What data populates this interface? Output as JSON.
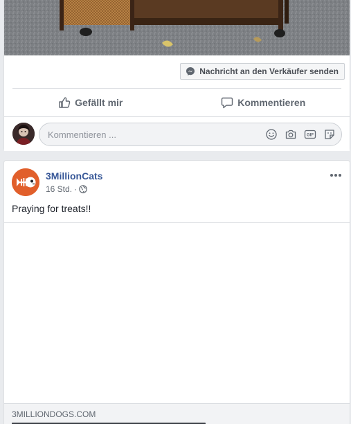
{
  "post1": {
    "message_seller_label": "Nachricht an den Verkäufer senden",
    "like_label": "Gefällt mir",
    "comment_label": "Kommentieren",
    "comment_placeholder": "Kommentieren ...",
    "comment_tool_icons": [
      "emoji-icon",
      "camera-icon",
      "gif-icon",
      "sticker-icon"
    ]
  },
  "post2": {
    "page_name": "3MillionCats",
    "timestamp": "16 Std.",
    "meta_separator": "·",
    "audience_icon": "globe-icon",
    "text": "Praying for treats!!",
    "link_domain": "3MILLIONDOGS.COM"
  },
  "colors": {
    "link_blue": "#385898",
    "page_avatar": "#e15f2b",
    "background": "#e9ebee",
    "button_gray": "#606770"
  }
}
